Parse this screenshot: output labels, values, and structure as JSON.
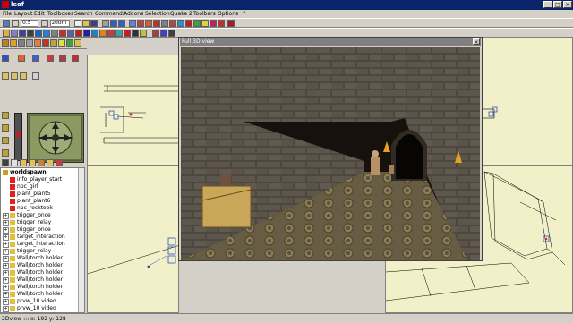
{
  "app": {
    "title": "leaf"
  },
  "window_buttons": {
    "minimize": "_",
    "maximize": "□",
    "close": "×"
  },
  "menu": [
    {
      "label": "File"
    },
    {
      "label": "Layout"
    },
    {
      "label": "Edit"
    },
    {
      "label": "Toolboxes"
    },
    {
      "label": "Search"
    },
    {
      "label": "Commands"
    },
    {
      "label": "Addons"
    },
    {
      "label": "Selection"
    },
    {
      "label": "Quake 2"
    },
    {
      "label": "Toolbars"
    },
    {
      "label": "Options"
    },
    {
      "label": "?"
    }
  ],
  "toolbar": {
    "grid_value": "0.5",
    "zoom_value": "zoom"
  },
  "view3d": {
    "title": "Full 3D view",
    "close": "×"
  },
  "tree": {
    "items": [
      {
        "label": "worldspawn",
        "expander": "",
        "icon": "world-icon",
        "color": "#c8a020"
      },
      {
        "label": "info_player_start",
        "expander": "",
        "icon": "entity-icon",
        "color": "#e02020"
      },
      {
        "label": "npc_girl",
        "expander": "",
        "icon": "entity-icon",
        "color": "#e02020"
      },
      {
        "label": "plant_plant5",
        "expander": "",
        "icon": "entity-icon",
        "color": "#e02020"
      },
      {
        "label": "plant_plant6",
        "expander": "",
        "icon": "entity-icon",
        "color": "#e02020"
      },
      {
        "label": "npc_rocktook",
        "expander": "",
        "icon": "entity-icon",
        "color": "#e02020"
      },
      {
        "label": "trigger_once",
        "expander": "+",
        "icon": "folder-icon",
        "color": "#e0c040"
      },
      {
        "label": "trigger_relay",
        "expander": "+",
        "icon": "folder-icon",
        "color": "#e0c040"
      },
      {
        "label": "trigger_once",
        "expander": "+",
        "icon": "folder-icon",
        "color": "#e0c040"
      },
      {
        "label": "target_interaction",
        "expander": "+",
        "icon": "folder-icon",
        "color": "#e0c040"
      },
      {
        "label": "target_interaction",
        "expander": "+",
        "icon": "folder-icon",
        "color": "#e0c040"
      },
      {
        "label": "trigger_relay",
        "expander": "+",
        "icon": "folder-icon",
        "color": "#e0c040"
      },
      {
        "label": "Wall/torch holder",
        "expander": "+",
        "icon": "folder-icon",
        "color": "#e0c040"
      },
      {
        "label": "Wall/torch holder",
        "expander": "+",
        "icon": "folder-icon",
        "color": "#e0c040"
      },
      {
        "label": "Wall/torch holder",
        "expander": "+",
        "icon": "folder-icon",
        "color": "#e0c040"
      },
      {
        "label": "Wall/torch holder",
        "expander": "+",
        "icon": "folder-icon",
        "color": "#e0c040"
      },
      {
        "label": "Wall/torch holder",
        "expander": "+",
        "icon": "folder-icon",
        "color": "#e0c040"
      },
      {
        "label": "Wall/torch holder",
        "expander": "+",
        "icon": "folder-icon",
        "color": "#e0c040"
      },
      {
        "label": "prvw_10 video",
        "expander": "+",
        "icon": "folder-icon",
        "color": "#e0c040"
      },
      {
        "label": "prvw_10 video",
        "expander": "+",
        "icon": "folder-icon",
        "color": "#e0c040"
      },
      {
        "label": "prvw_10 video",
        "expander": "+",
        "icon": "folder-icon",
        "color": "#e0c040"
      }
    ]
  },
  "status": {
    "text": "2Dview ::: x: 192  y:-128"
  },
  "colors": {
    "titlebar": "#0a246a",
    "viewport_bg": "#f2f0c8",
    "chrome": "#d4d0c8"
  }
}
